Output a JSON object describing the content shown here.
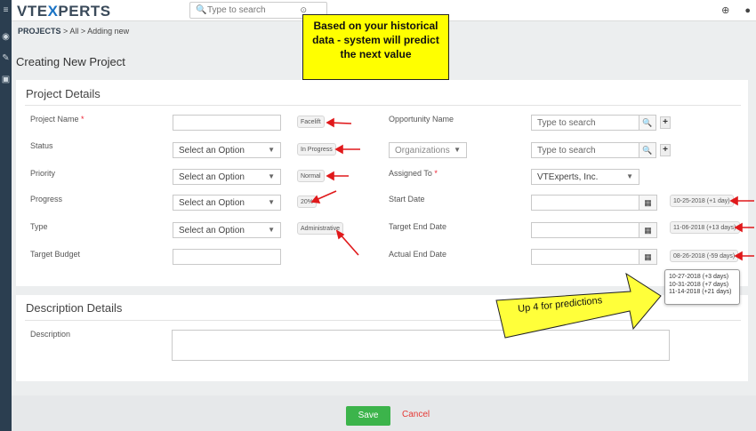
{
  "topbar": {
    "logo_prefix": "VTE",
    "logo_x": "X",
    "logo_suffix": "PERTS",
    "search_placeholder": "Type to search"
  },
  "breadcrumb": {
    "module": "PROJECTS",
    "sep1": ">",
    "all": "All",
    "sep2": ">",
    "current": "Adding new"
  },
  "page_title": "Creating New Project",
  "callout": {
    "line1": "Based on your historical",
    "line2": "data - system will predict",
    "line3": "the next value"
  },
  "project_details": {
    "title": "Project Details",
    "project_name_label": "Project Name",
    "required_mark": "*",
    "status_label": "Status",
    "priority_label": "Priority",
    "progress_label": "Progress",
    "type_label": "Type",
    "target_budget_label": "Target Budget",
    "select_option": "Select an Option",
    "suggestions": {
      "name": "Facelift",
      "status": "In Progress",
      "priority": "Normal",
      "progress": "20%",
      "type": "Administrative"
    },
    "opportunity_label": "Opportunity Name",
    "opportunity_placeholder": "Type to search",
    "organizations_select": "Organizations",
    "organizations_placeholder": "Type to search",
    "assigned_label": "Assigned To",
    "assigned_value": "VTExperts, Inc.",
    "start_date_label": "Start Date",
    "target_end_label": "Target End Date",
    "actual_end_label": "Actual End Date",
    "date_suggestions": {
      "start": "10-25-2018 (+1 day)",
      "target_end": "11-06-2018 (+13 days)",
      "actual_end": "08-26-2018 (-59 days)"
    },
    "more_predictions": [
      "10-27-2018 (+3 days)",
      "10-31-2018 (+7 days)",
      "11-14-2018 (+21 days)"
    ]
  },
  "annotation_up4": "Up  4 for predictions",
  "description_details": {
    "title": "Description Details",
    "description_label": "Description"
  },
  "footer": {
    "save": "Save",
    "cancel": "Cancel"
  }
}
